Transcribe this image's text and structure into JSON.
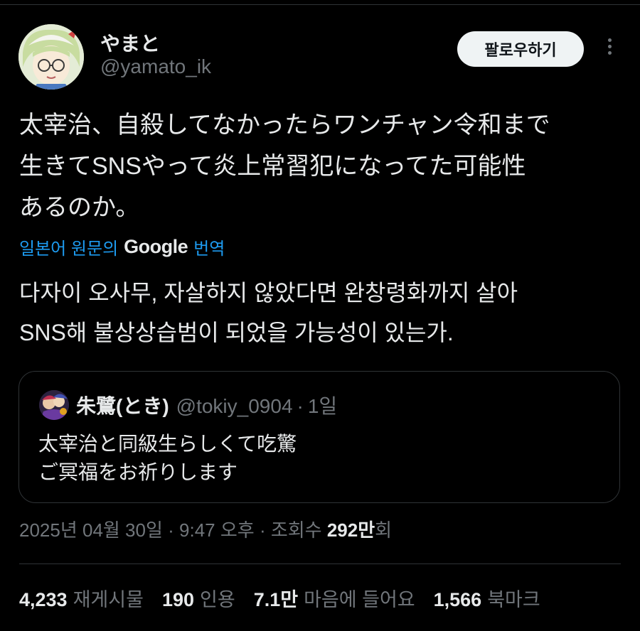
{
  "author": {
    "display_name": "やまと",
    "handle": "@yamato_ik",
    "avatar_icon": "anime-character-avatar"
  },
  "follow_button_label": "팔로우하기",
  "more_icon": "more-dots-vertical-icon",
  "tweet_text": "太宰治、自殺してなかったらワンチャン令和まで\n生きてSNSやって炎上常習犯になってた可能性\nあるのか。",
  "translation": {
    "prefix": "일본어 원문의",
    "brand": "Google",
    "suffix": "번역",
    "text": "다자이 오사무, 자살하지 않았다면 완창령화까지 살아\nSNS해 불상상습범이 되었을 가능성이 있는가."
  },
  "quote": {
    "avatar_icon": "anime-group-avatar",
    "name": "朱鷺(とき)",
    "handle": "@tokiy_0904",
    "separator": "·",
    "time": "1일",
    "text": "太宰治と同級生らしくて吃驚\nご冥福をお祈りします"
  },
  "meta": {
    "date": "2025년 04월 30일",
    "sep1": "·",
    "time": "9:47 오후",
    "sep2": "·",
    "views_label": "조회수",
    "views_count": "292만",
    "views_suffix": "회"
  },
  "stats": [
    {
      "count": "4,233",
      "label": "재게시물"
    },
    {
      "count": "190",
      "label": "인용"
    },
    {
      "count": "7.1만",
      "label": "마음에 들어요"
    },
    {
      "count": "1,566",
      "label": "북마크"
    }
  ],
  "colors": {
    "background": "#000000",
    "text": "#e7e9ea",
    "secondary": "#71767b",
    "link": "#1d9bf0",
    "border": "#2f3336"
  }
}
